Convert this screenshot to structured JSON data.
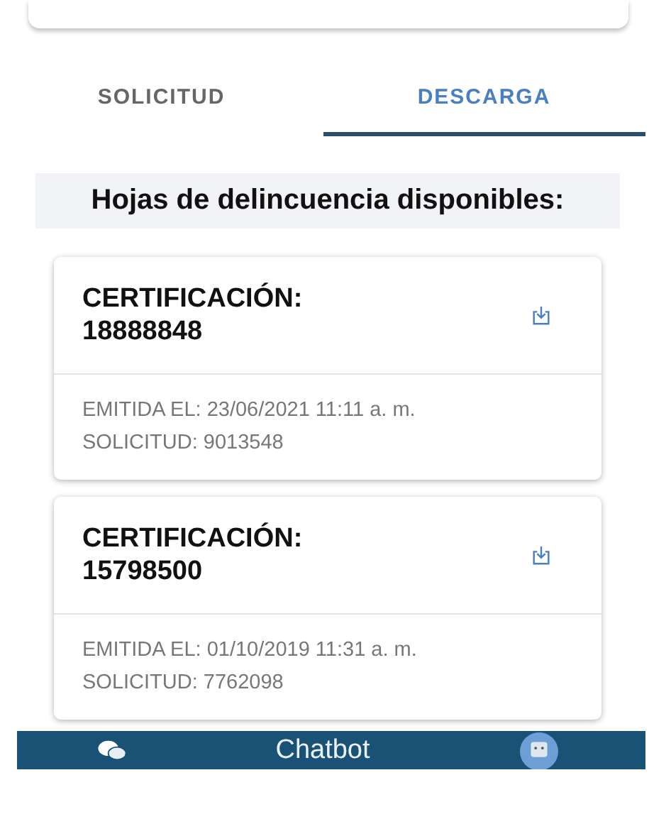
{
  "tabs": [
    {
      "label": "SOLICITUD",
      "selected": false
    },
    {
      "label": "DESCARGA",
      "selected": true
    }
  ],
  "heading": "Hojas de delincuencia disponibles:",
  "certificates": [
    {
      "title": "CERTIFICACIÓN:",
      "number": "18888848",
      "issued": "EMITIDA EL: 23/06/2021 11:11 a. m.",
      "request": "SOLICITUD: 9013548"
    },
    {
      "title": "CERTIFICACIÓN:",
      "number": "15798500",
      "issued": "EMITIDA EL: 01/10/2019 11:31 a. m.",
      "request": "SOLICITUD: 7762098"
    }
  ],
  "chatbot": {
    "label": "Chatbot"
  }
}
